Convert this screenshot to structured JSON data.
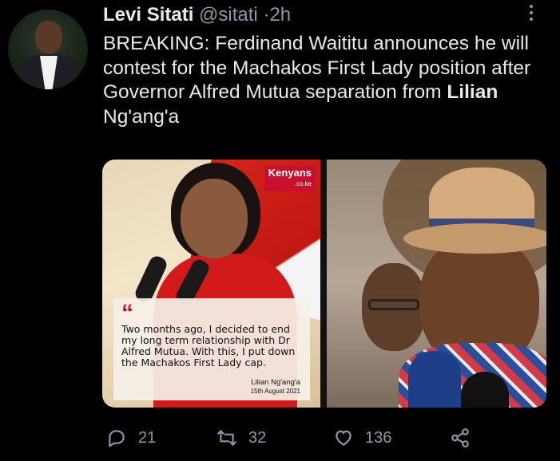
{
  "tweet": {
    "author_name": "Levi Sitati",
    "author_handle": "@sitati",
    "separator": "·",
    "time": "2h",
    "text_prefix": "BREAKING: Ferdinand Waititu announces he will contest for the Machakos First Lady position after Governor Alfred Mutua separation from ",
    "mention": "Lilian",
    "text_suffix": " Ng'ang'a"
  },
  "media": {
    "watermark": "Kenyans",
    "watermark_sub": ".co.ke",
    "quote_mark": "“",
    "quote_text": "Two months ago, I decided to end my long term relationship with Dr Alfred Mutua. With this, I put down the Machakos First Lady cap.",
    "quote_author": "Lilian Ng'ang'a",
    "quote_date": "15th August 2021"
  },
  "actions": {
    "replies": "21",
    "retweets": "32",
    "likes": "136"
  },
  "icons": {
    "more": "more-icon",
    "reply": "reply-icon",
    "retweet": "retweet-icon",
    "like": "heart-icon",
    "share": "share-icon"
  },
  "colors": {
    "background": "#000000",
    "text": "#e7e9ea",
    "muted": "#8b98a5",
    "accent": "#c8102e"
  }
}
